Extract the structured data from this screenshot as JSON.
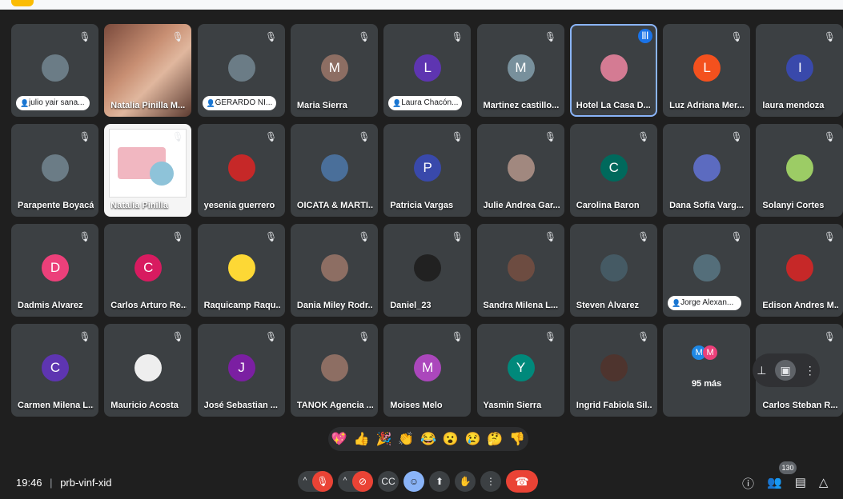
{
  "meeting": {
    "time": "19:46",
    "separator": "|",
    "code": "prb-vinf-xid",
    "people_count": "130"
  },
  "participants": [
    {
      "name": "julio yair sana...",
      "style": "pill",
      "avatar": "photo"
    },
    {
      "name": "Natalia Pinilla M...",
      "style": "plain",
      "avatar": "video1"
    },
    {
      "name": "GERARDO NI...",
      "style": "pill",
      "avatar": "photo"
    },
    {
      "name": "Maria Sierra",
      "style": "plain",
      "avatar": "letter",
      "letter": "M",
      "color": "#8d6e63"
    },
    {
      "name": "Laura Chacón...",
      "style": "pill",
      "avatar": "letter",
      "letter": "L",
      "color": "#5e35b1"
    },
    {
      "name": "Martinez castillo...",
      "style": "plain",
      "avatar": "letter",
      "letter": "M",
      "color": "#78909c"
    },
    {
      "name": "Hotel La Casa D...",
      "style": "plain",
      "avatar": "photo",
      "speaking": true,
      "color": "#d47b93"
    },
    {
      "name": "Luz Adriana Mer...",
      "style": "plain",
      "avatar": "letter",
      "letter": "L",
      "color": "#f4511e"
    },
    {
      "name": "laura mendoza",
      "style": "plain",
      "avatar": "letter",
      "letter": "I",
      "color": "#3949ab"
    },
    {
      "name": "Parapente Boyacá",
      "style": "plain",
      "avatar": "photo"
    },
    {
      "name": "Natalia Pinilla",
      "style": "plain",
      "avatar": "video2"
    },
    {
      "name": "yesenia guerrero",
      "style": "plain",
      "avatar": "photo",
      "color": "#c62828"
    },
    {
      "name": "OICATA & MARTI...",
      "style": "plain",
      "avatar": "photo",
      "color": "#4a6f9a"
    },
    {
      "name": "Patricia Vargas",
      "style": "plain",
      "avatar": "letter",
      "letter": "P",
      "color": "#3949ab"
    },
    {
      "name": "Julie Andrea Gar...",
      "style": "plain",
      "avatar": "photo",
      "color": "#a1887f"
    },
    {
      "name": "Carolina Baron",
      "style": "plain",
      "avatar": "letter",
      "letter": "C",
      "color": "#00695c"
    },
    {
      "name": "Dana Sofía Varg...",
      "style": "plain",
      "avatar": "photo",
      "color": "#5c6bc0"
    },
    {
      "name": "Solanyi Cortes",
      "style": "plain",
      "avatar": "photo",
      "color": "#9ccc65"
    },
    {
      "name": "Dadmis Alvarez",
      "style": "plain",
      "avatar": "letter",
      "letter": "D",
      "color": "#ec407a"
    },
    {
      "name": "Carlos Arturo Re...",
      "style": "plain",
      "avatar": "letter",
      "letter": "C",
      "color": "#d81b60"
    },
    {
      "name": "Raquicamp Raqu...",
      "style": "plain",
      "avatar": "photo",
      "color": "#fdd835"
    },
    {
      "name": "Dania Miley Rodr...",
      "style": "plain",
      "avatar": "photo",
      "color": "#8d6e63"
    },
    {
      "name": "Daniel_23",
      "style": "plain",
      "avatar": "photo",
      "color": "#212121"
    },
    {
      "name": "Sandra Milena L...",
      "style": "plain",
      "avatar": "photo",
      "color": "#6d4c41"
    },
    {
      "name": "Steven Álvarez",
      "style": "plain",
      "avatar": "photo",
      "color": "#455a64"
    },
    {
      "name": "Jorge Alexan...",
      "style": "pill",
      "avatar": "photo",
      "color": "#546e7a"
    },
    {
      "name": "Edison Andres M...",
      "style": "plain",
      "avatar": "photo",
      "color": "#c62828"
    },
    {
      "name": "Carmen Milena L...",
      "style": "plain",
      "avatar": "letter",
      "letter": "C",
      "color": "#5e35b1"
    },
    {
      "name": "Mauricio Acosta",
      "style": "plain",
      "avatar": "photo",
      "color": "#eeeeee"
    },
    {
      "name": "José Sebastian ...",
      "style": "plain",
      "avatar": "letter",
      "letter": "J",
      "color": "#7b1fa2"
    },
    {
      "name": "TANOK Agencia ...",
      "style": "plain",
      "avatar": "photo",
      "color": "#8d6e63"
    },
    {
      "name": "Moises Melo",
      "style": "plain",
      "avatar": "letter",
      "letter": "M",
      "color": "#ab47bc"
    },
    {
      "name": "Yasmin Sierra",
      "style": "plain",
      "avatar": "letter",
      "letter": "Y",
      "color": "#00897b"
    },
    {
      "name": "Ingrid Fabiola Sil...",
      "style": "plain",
      "avatar": "photo",
      "color": "#4e342e"
    },
    {
      "name": "more",
      "style": "more",
      "label": "95 más",
      "letters": [
        "M",
        "M"
      ]
    },
    {
      "name": "Carlos Steban R...",
      "style": "plain",
      "avatar": "none"
    }
  ],
  "reactions": [
    "💖",
    "👍",
    "🎉",
    "👏",
    "😂",
    "😮",
    "😢",
    "🤔",
    "👎"
  ],
  "controls": [
    "mic-off",
    "camera-off",
    "captions",
    "emoji",
    "present",
    "raise-hand",
    "more",
    "leave"
  ]
}
